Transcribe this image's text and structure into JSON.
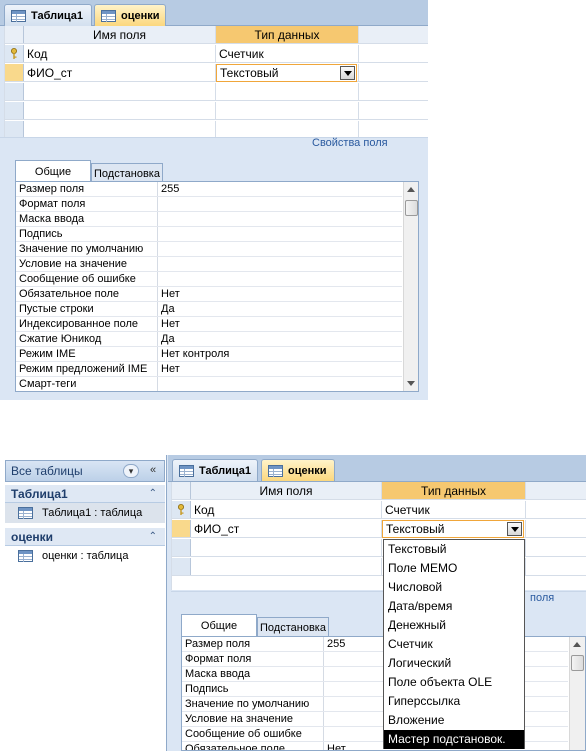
{
  "top": {
    "tabs": [
      {
        "label": "Таблица1"
      },
      {
        "label": "оценки"
      }
    ],
    "grid": {
      "col_field": "Имя поля",
      "col_type": "Тип данных",
      "rows": [
        {
          "field": "Код",
          "type": "Счетчик"
        },
        {
          "field": "ФИО_ст",
          "type": "Текстовый"
        }
      ]
    },
    "props_title": "Свойства поля",
    "prop_tabs": {
      "general": "Общие",
      "lookup": "Подстановка"
    },
    "properties": [
      {
        "name": "Размер поля",
        "value": "255"
      },
      {
        "name": "Формат поля",
        "value": ""
      },
      {
        "name": "Маска ввода",
        "value": ""
      },
      {
        "name": "Подпись",
        "value": ""
      },
      {
        "name": "Значение по умолчанию",
        "value": ""
      },
      {
        "name": "Условие на значение",
        "value": ""
      },
      {
        "name": "Сообщение об ошибке",
        "value": ""
      },
      {
        "name": "Обязательное поле",
        "value": "Нет"
      },
      {
        "name": "Пустые строки",
        "value": "Да"
      },
      {
        "name": "Индексированное поле",
        "value": "Нет"
      },
      {
        "name": "Сжатие Юникод",
        "value": "Да"
      },
      {
        "name": "Режим IME",
        "value": "Нет контроля"
      },
      {
        "name": "Режим предложений IME",
        "value": "Нет"
      },
      {
        "name": "Смарт-теги",
        "value": ""
      }
    ]
  },
  "bottom": {
    "nav": {
      "header": "Все таблицы",
      "groups": [
        {
          "title": "Таблица1",
          "item": "Таблица1 : таблица"
        },
        {
          "title": "оценки",
          "item": "оценки : таблица"
        }
      ]
    },
    "tabs": [
      {
        "label": "Таблица1"
      },
      {
        "label": "оценки"
      }
    ],
    "grid": {
      "col_field": "Имя поля",
      "col_type": "Тип данных",
      "rows": [
        {
          "field": "Код",
          "type": "Счетчик"
        },
        {
          "field": "ФИО_ст",
          "type": "Текстовый"
        }
      ]
    },
    "props_title_partial": "поля",
    "prop_tabs": {
      "general": "Общие",
      "lookup": "Подстановка"
    },
    "properties": [
      {
        "name": "Размер поля",
        "value": "255"
      },
      {
        "name": "Формат поля",
        "value": ""
      },
      {
        "name": "Маска ввода",
        "value": ""
      },
      {
        "name": "Подпись",
        "value": ""
      },
      {
        "name": "Значение по умолчанию",
        "value": ""
      },
      {
        "name": "Условие на значение",
        "value": ""
      },
      {
        "name": "Сообщение об ошибке",
        "value": ""
      },
      {
        "name": "Обязательное поле",
        "value": "Нет"
      }
    ],
    "dropdown": {
      "options": [
        "Текстовый",
        "Поле МЕМО",
        "Числовой",
        "Дата/время",
        "Денежный",
        "Счетчик",
        "Логический",
        "Поле объекта OLE",
        "Гиперссылка",
        "Вложение",
        "Мастер подстановок."
      ],
      "highlighted_index": 10
    }
  },
  "colors": {
    "tab_strip": "#b7cbe3",
    "active_tab": "#fbd77e",
    "type_header": "#f6c870",
    "current_row": "#f9d98c",
    "props_title": "#2a5a9f"
  }
}
